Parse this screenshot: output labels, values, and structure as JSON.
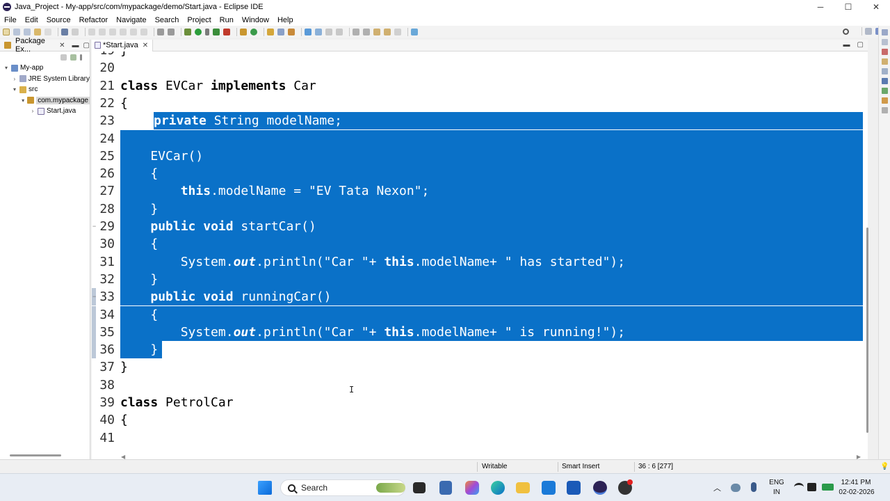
{
  "window": {
    "title": "Java_Project - My-app/src/com/mypackage/demo/Start.java - Eclipse IDE",
    "controls": [
      "─",
      "☐",
      "✕"
    ]
  },
  "menu": [
    "File",
    "Edit",
    "Source",
    "Refactor",
    "Navigate",
    "Search",
    "Project",
    "Run",
    "Window",
    "Help"
  ],
  "explorer": {
    "title": "Package Ex...",
    "tree": [
      {
        "label": "My-app",
        "depth": 0,
        "arrow": "▾",
        "icon": "project-icon"
      },
      {
        "label": "JRE System Library",
        "depth": 1,
        "arrow": "›",
        "icon": "library-icon"
      },
      {
        "label": "src",
        "depth": 1,
        "arrow": "▾",
        "icon": "source-folder-icon"
      },
      {
        "label": "com.mypackage",
        "depth": 2,
        "arrow": "▾",
        "icon": "package-icon"
      },
      {
        "label": "Start.java",
        "depth": 3,
        "arrow": "›",
        "icon": "java-file-icon"
      }
    ]
  },
  "editor": {
    "tab_label": "*Start.java",
    "lines": [
      {
        "num": "19",
        "code": "}"
      },
      {
        "num": "20",
        "code": ""
      },
      {
        "num": "21",
        "code": "class EVCar implements Car"
      },
      {
        "num": "22",
        "code": "{"
      },
      {
        "num": "23",
        "code": "    private String modelName;"
      },
      {
        "num": "24",
        "code": ""
      },
      {
        "num": "25",
        "code": "    EVCar()"
      },
      {
        "num": "26",
        "code": "    {"
      },
      {
        "num": "27",
        "code": "        this.modelName = \"EV Tata Nexon\";"
      },
      {
        "num": "28",
        "code": "    }"
      },
      {
        "num": "29",
        "code": "    public void startCar()"
      },
      {
        "num": "30",
        "code": "    {"
      },
      {
        "num": "31",
        "code": "        System.out.println(\"Car \"+ this.modelName+ \" has started\");"
      },
      {
        "num": "32",
        "code": "    }"
      },
      {
        "num": "33",
        "code": "    public void runningCar()"
      },
      {
        "num": "34",
        "code": "    {"
      },
      {
        "num": "35",
        "code": "        System.out.println(\"Car \"+ this.modelName+ \" is running!\");"
      },
      {
        "num": "36",
        "code": "    }"
      },
      {
        "num": "37",
        "code": "}"
      },
      {
        "num": "38",
        "code": ""
      },
      {
        "num": "39",
        "code": "class PetrolCar"
      },
      {
        "num": "40",
        "code": "{"
      },
      {
        "num": "41",
        "code": ""
      }
    ]
  },
  "status": {
    "writable": "Writable",
    "insert_mode": "Smart Insert",
    "position": "36 : 6 [277]"
  },
  "taskbar": {
    "search_label": "Search",
    "language": "ENG",
    "region": "IN",
    "time": "12:41 PM",
    "date": "02-02-2026"
  },
  "colors": {
    "selection": "#0a71c8",
    "keyword": "#7f0055",
    "string": "#2a00ff",
    "field": "#0000c0"
  }
}
